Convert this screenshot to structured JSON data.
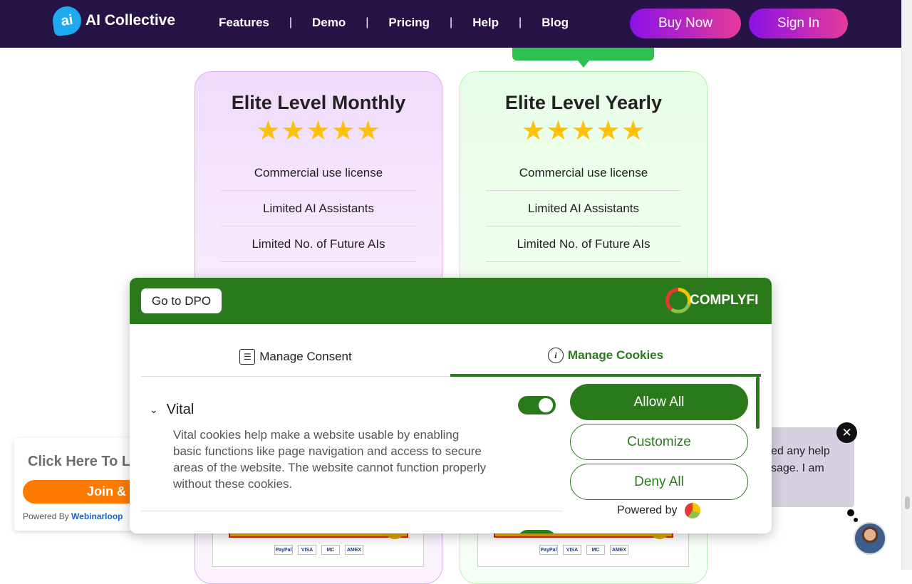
{
  "header": {
    "logo_badge": "ai",
    "logo_text": "AI Collective",
    "nav": [
      "Features",
      "Demo",
      "Pricing",
      "Help",
      "Blog"
    ],
    "nav_separator": "|",
    "buy_now": "Buy Now",
    "sign_in": "Sign In"
  },
  "plans": [
    {
      "title": "Elite Level Monthly",
      "stars": "★★★★★",
      "features": [
        "Commercial use license",
        "Limited AI Assistants",
        "Limited No. of Future AIs"
      ],
      "payment_logos": [
        "PayPal",
        "VISA",
        "MC",
        "AMEX"
      ]
    },
    {
      "title": "Elite Level Yearly",
      "stars": "★★★★★",
      "features": [
        "Commercial use license",
        "Limited AI Assistants",
        "Limited No. of Future AIs"
      ],
      "payment_logos": [
        "PayPal",
        "VISA",
        "MC",
        "AMEX"
      ]
    }
  ],
  "webinar_widget": {
    "title": "Click Here To La",
    "button": "Join &",
    "powered_by_prefix": "Powered By ",
    "powered_by_brand": "Webinarloop"
  },
  "chat_widget": {
    "message": "ed any help sage. I am",
    "close": "✕"
  },
  "consent_modal": {
    "go_to_dpo": "Go to DPO",
    "brand": "COMPLYFI",
    "tabs": {
      "manage_consent": "Manage Consent",
      "manage_cookies": "Manage Cookies",
      "active": "Manage Cookies"
    },
    "section_title": "Vital",
    "section_description": "Vital cookies help make a website usable by enabling basic functions like page navigation and access to secure areas of the website. The website cannot function properly without these cookies.",
    "vital_toggle_on": true,
    "buttons": {
      "allow_all": "Allow All",
      "customize": "Customize",
      "deny_all": "Deny All"
    },
    "powered_by": "Powered by"
  },
  "colors": {
    "header_bg": "#261447",
    "consent_green": "#2a7a1c",
    "star_yellow": "#ffc107",
    "webinar_orange": "#ff7a00"
  }
}
